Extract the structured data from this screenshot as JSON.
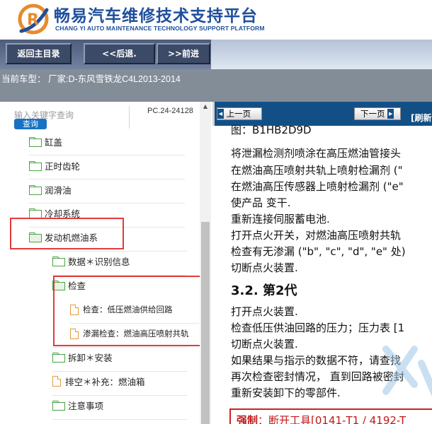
{
  "header": {
    "title": "畅易汽车维修技术支持平台",
    "subtitle": "CHANG YI AUTO MAINTENANCE TECHNOLOGY SUPPORT PLATFORM",
    "logo_letter": "R"
  },
  "toolbar": {
    "home_label": "返回主目录",
    "back_label": "<<后退.",
    "forward_label": ">>前进"
  },
  "vehicle": {
    "text": "当前车型：  厂家:D-东风雪铁龙C4L2013-2014"
  },
  "search": {
    "placeholder": "输入关键字查询",
    "button_label": "查询",
    "code": "PC.24-24128"
  },
  "tree": {
    "items": [
      {
        "label": "缸盖",
        "icon": "folder-icon"
      },
      {
        "label": "正时齿轮",
        "icon": "folder-icon"
      },
      {
        "label": "润滑油",
        "icon": "folder-icon"
      },
      {
        "label": "冷却系统",
        "icon": "folder-icon"
      },
      {
        "label": "发动机燃油系",
        "icon": "folder-open-icon"
      },
      {
        "label": "数据＊识别信息",
        "icon": "folder-icon"
      },
      {
        "label": "检查",
        "icon": "folder-open-icon"
      },
      {
        "label": "检查：低压燃油供给回路",
        "icon": "document-icon"
      },
      {
        "label": "渗漏检查：燃油高压喷射共轨",
        "icon": "document-icon"
      },
      {
        "label": "拆卸＊安装",
        "icon": "folder-icon"
      },
      {
        "label": "排空＊补充：燃油箱",
        "icon": "document-icon"
      },
      {
        "label": "注意事项",
        "icon": "folder-icon"
      }
    ]
  },
  "pager": {
    "prev_label": "上一页",
    "next_label": "下一页",
    "refresh_label": "[刷新"
  },
  "document": {
    "top_partial": "图：B1HB2D9D",
    "paragraphs_1": [
      "将泄漏检测剂喷涂在高压燃油管接头",
      "在燃油高压喷射共轨上喷射检漏剂 (\"",
      "在燃油高压传感器上喷射检漏剂 (\"e\"",
      "使产品 变干.",
      "重新连接伺服蓄电池.",
      "打开点火开关，对燃油高压喷射共轨",
      "检查有无渗漏 (\"b\", \"c\", \"d\", \"e\" 处)",
      "切断点火装置."
    ],
    "heading": "3.2. 第2代",
    "paragraphs_2": [
      "打开点火装置.",
      "检查低压供油回路的压力；压力表 [1",
      "切断点火装置.",
      "如果结果与指示的数据不符，请查找",
      "再次检查密封情况， 直到回路被密封",
      "重新安装卸下的零部件."
    ],
    "warning_label": "强制",
    "warning_text": "：断开工具[0141-T1 / 4192-T"
  },
  "colors": {
    "brand_blue": "#1f4f9c",
    "highlight_red": "#e23b3b",
    "pager_bar": "#134f87",
    "folder_green": "#4aa244",
    "doc_orange": "#e29a3a"
  }
}
